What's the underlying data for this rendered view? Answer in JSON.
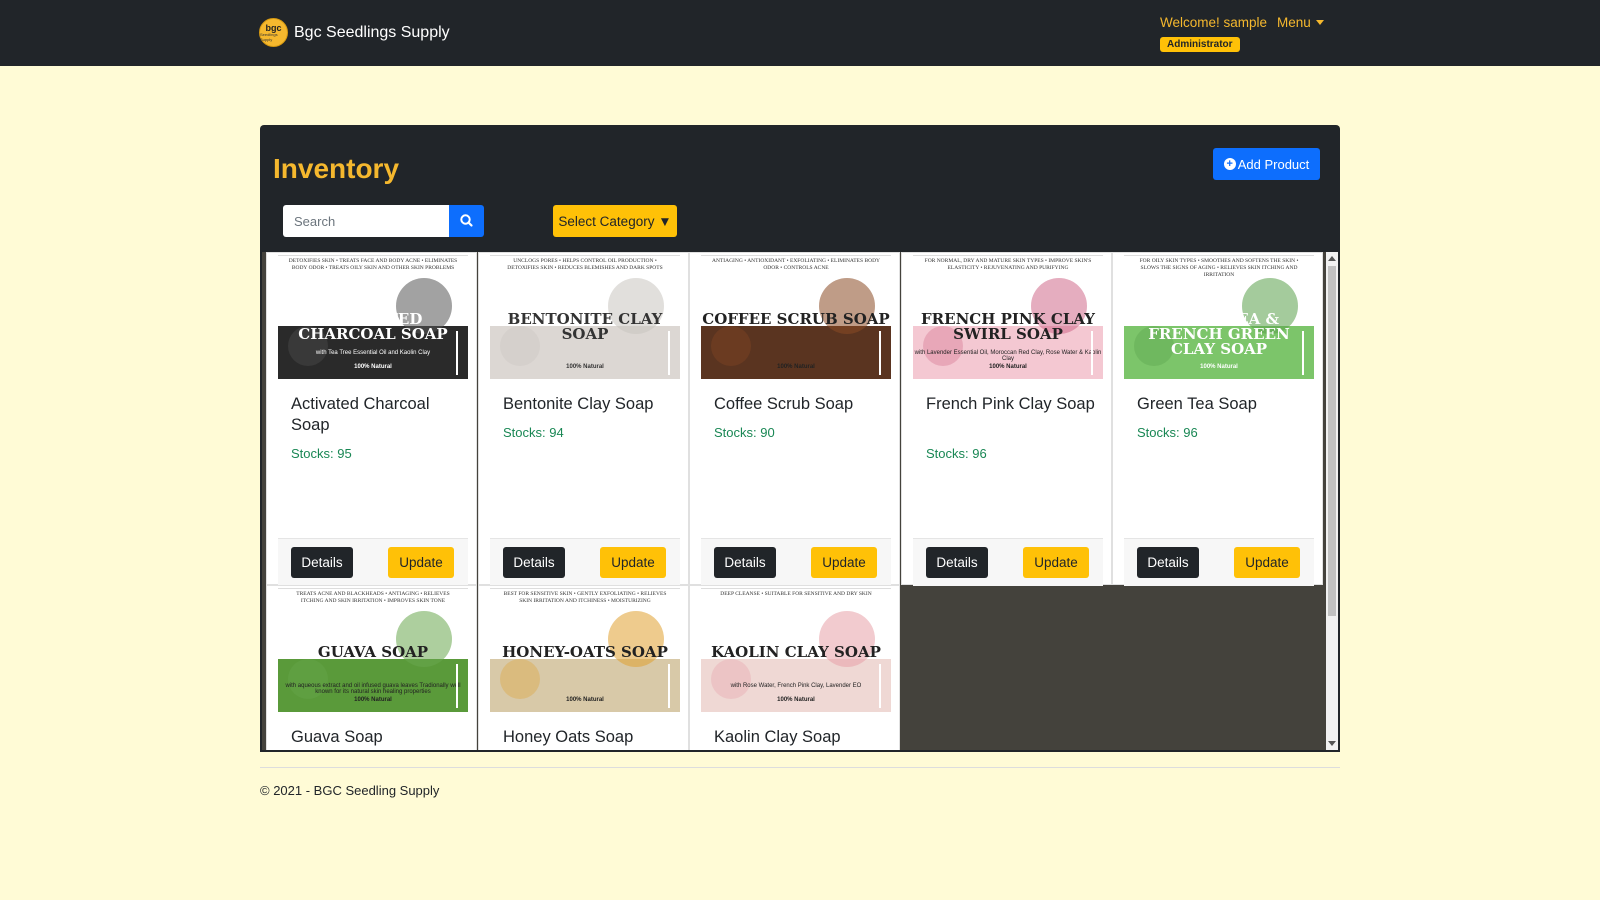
{
  "header": {
    "logo_text": "bgc",
    "logo_sub": "Seedlings Supply",
    "brand": "Bgc Seedlings Supply",
    "welcome": "Welcome! sample",
    "menu_label": "Menu",
    "role": "Administrator"
  },
  "inventory": {
    "title": "Inventory",
    "add_label": "Add Product",
    "search_placeholder": "Search",
    "category_label": "Select Category ▼"
  },
  "buttons": {
    "details": "Details",
    "update": "Update"
  },
  "products": [
    {
      "name": "Activated Charcoal Soap",
      "stock": "Stocks: 95",
      "img_tags": "DETOXIFIES SKIN • TREATS FACE AND BODY ACNE • ELIMINATES BODY ODOR • TREATS OILY SKIN AND OTHER SKIN PROBLEMS",
      "img_name": "ACTIVATED CHARCOAL SOAP",
      "img_sub": "with Tea Tree Essential Oil and Kaolin Clay",
      "img_nat": "100% Natural",
      "colors": {
        "band": "#2a2a2a",
        "name": "#ffffff",
        "deco": "#555555"
      }
    },
    {
      "name": "Bentonite Clay Soap",
      "stock": "Stocks: 94",
      "img_tags": "UNCLOGS PORES • HELPS CONTROL OIL PRODUCTION • DETOXIFIES SKIN • REDUCES BLEMISHES AND DARK SPOTS",
      "img_name": "BENTONITE CLAY SOAP",
      "img_sub": "",
      "img_nat": "100% Natural",
      "colors": {
        "band": "#dcd7d3",
        "name": "#333333",
        "deco": "#c9c4bf"
      }
    },
    {
      "name": "Coffee Scrub Soap",
      "stock": "Stocks: 90",
      "img_tags": "ANTIAGING • ANTIOXIDANT • EXFOLIATING • ELIMINATES BODY ODOR • CONTROLS ACNE",
      "img_name": "COFFEE SCRUB SOAP",
      "img_sub": "",
      "img_nat": "100% Natural",
      "colors": {
        "band": "#5a3420",
        "name": "#222222",
        "deco": "#8b4a25"
      }
    },
    {
      "name": "French Pink Clay Soap",
      "stock": "Stocks: 96",
      "img_tags": "FOR NORMAL, DRY AND MATURE SKIN TYPES • IMPROVE SKIN'S ELASTICITY • REJUVENATING AND PURIFYING",
      "img_name": "FRENCH PINK CLAY SWIRL SOAP",
      "img_sub": "with Lavender Essential Oil, Moroccan Red Clay, Rose Water & Kaolin Clay",
      "img_nat": "100% Natural",
      "colors": {
        "band": "#f4c8d2",
        "name": "#222222",
        "deco": "#d06a8a"
      }
    },
    {
      "name": "Green Tea Soap",
      "stock": "Stocks: 96",
      "img_tags": "FOR OILY SKIN TYPES • SMOOTHES AND SOFTENS THE SKIN • SLOWS THE SIGNS OF AGING • RELIEVES SKIN ITCHING AND IRRITATION",
      "img_name": "GREEN TEA & FRENCH GREEN CLAY SOAP",
      "img_sub": "",
      "img_nat": "100% Natural",
      "colors": {
        "band": "#7cc56a",
        "name": "#ffffff",
        "deco": "#5aa04a"
      }
    },
    {
      "name": "Guava Soap",
      "stock": "",
      "img_tags": "TREATS ACNE AND BLACKHEADS • ANTIAGING • RELIEVES ITCHING AND SKIN IRRITATION • IMPROVES SKIN TONE",
      "img_name": "GUAVA SOAP",
      "img_sub": "with aqueous extract and oil infused guava leaves Tradionally well known for its natural skin healing properties",
      "img_nat": "100% Natural",
      "colors": {
        "band": "#5a9a3a",
        "name": "#222222",
        "deco": "#6aa84f"
      }
    },
    {
      "name": "Honey Oats Soap",
      "stock": "",
      "img_tags": "BEST FOR SENSITIVE SKIN • GENTLY EXFOLIATING • RELIEVES SKIN IRRITATION AND ITCHINESS • MOISTURIZING",
      "img_name": "HONEY-OATS SOAP",
      "img_sub": "",
      "img_nat": "100% Natural",
      "colors": {
        "band": "#d8c9a8",
        "name": "#222222",
        "deco": "#e0a030"
      }
    },
    {
      "name": "Kaolin Clay Soap",
      "stock": "",
      "img_tags": "DEEP CLEANSE • SUITABLE FOR SENSITIVE AND DRY SKIN",
      "img_name": "KAOLIN CLAY SOAP",
      "img_sub": "with Rose Water, French Pink Clay, Lavender EO",
      "img_nat": "100% Natural",
      "colors": {
        "band": "#efd8d4",
        "name": "#222222",
        "deco": "#e8a0a8"
      }
    }
  ],
  "footer": {
    "text": "© 2021 - BGC Seedling Supply"
  }
}
